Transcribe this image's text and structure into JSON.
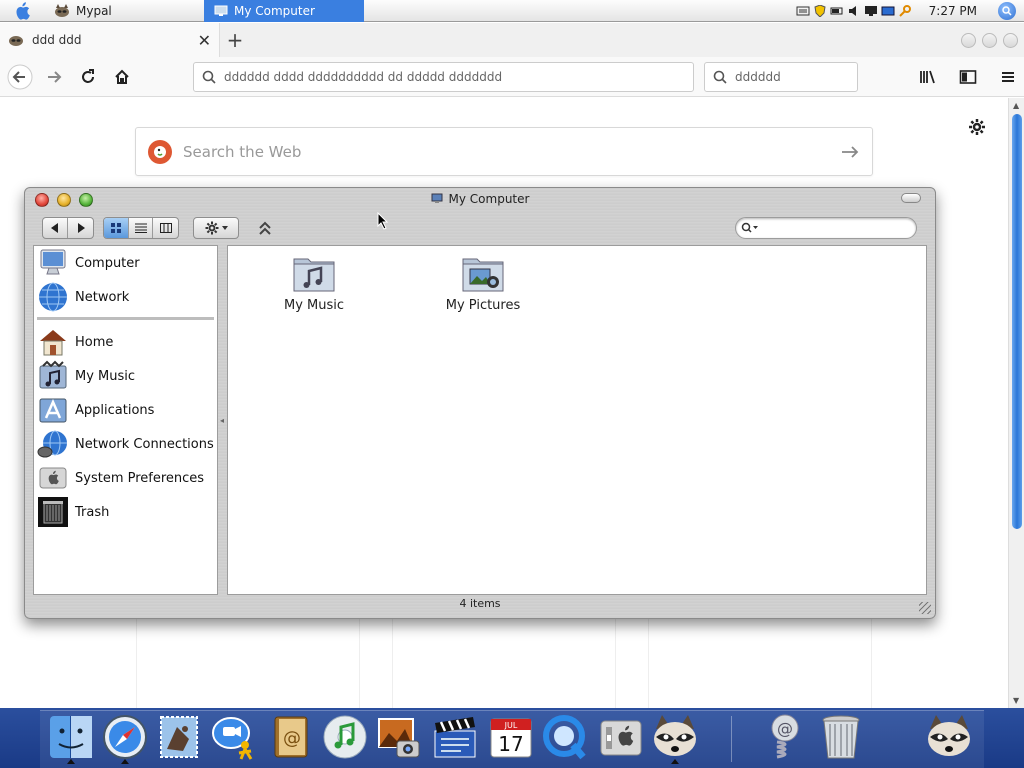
{
  "menubar": {
    "tasks": [
      {
        "label": "Mypal",
        "active": false
      },
      {
        "label": "My Computer",
        "active": true
      }
    ],
    "clock": "7:27 PM"
  },
  "browser": {
    "tab_title": "ddd ddd",
    "url_placeholder": "dddddd dddd dddddddddd dd ddddd ddddddd",
    "search_placeholder": "dddddd",
    "web_search_placeholder": "Search the Web"
  },
  "finder": {
    "title": "My Computer",
    "sidebar_top": [
      {
        "label": "Computer",
        "icon": "computer-icon"
      },
      {
        "label": "Network",
        "icon": "network-globe-icon"
      }
    ],
    "sidebar_bottom": [
      {
        "label": "Home",
        "icon": "home-icon"
      },
      {
        "label": "My Music",
        "icon": "music-icon"
      },
      {
        "label": "Applications",
        "icon": "applications-icon"
      },
      {
        "label": "Network Connections",
        "icon": "network-connections-icon"
      },
      {
        "label": "System Preferences",
        "icon": "system-preferences-icon"
      },
      {
        "label": "Trash",
        "icon": "trash-icon"
      }
    ],
    "items": [
      {
        "label": "My Music",
        "icon": "music-folder-icon"
      },
      {
        "label": "My Pictures",
        "icon": "pictures-folder-icon"
      }
    ],
    "status": "4 items"
  },
  "dock": {
    "calendar": {
      "month": "JUL",
      "day": "17"
    },
    "items": [
      "finder",
      "safari",
      "mail",
      "ichat",
      "address-book",
      "itunes",
      "iphoto",
      "imovie",
      "ical",
      "quicktime",
      "system-preferences",
      "mypal",
      "email-at",
      "trash",
      "mypal-2"
    ]
  },
  "colors": {
    "accent": "#3a7fe0",
    "dock_bg": "#1a3a86",
    "traffic_red": "#e2463a",
    "traffic_yellow": "#e6b12a",
    "traffic_green": "#55b43a"
  }
}
